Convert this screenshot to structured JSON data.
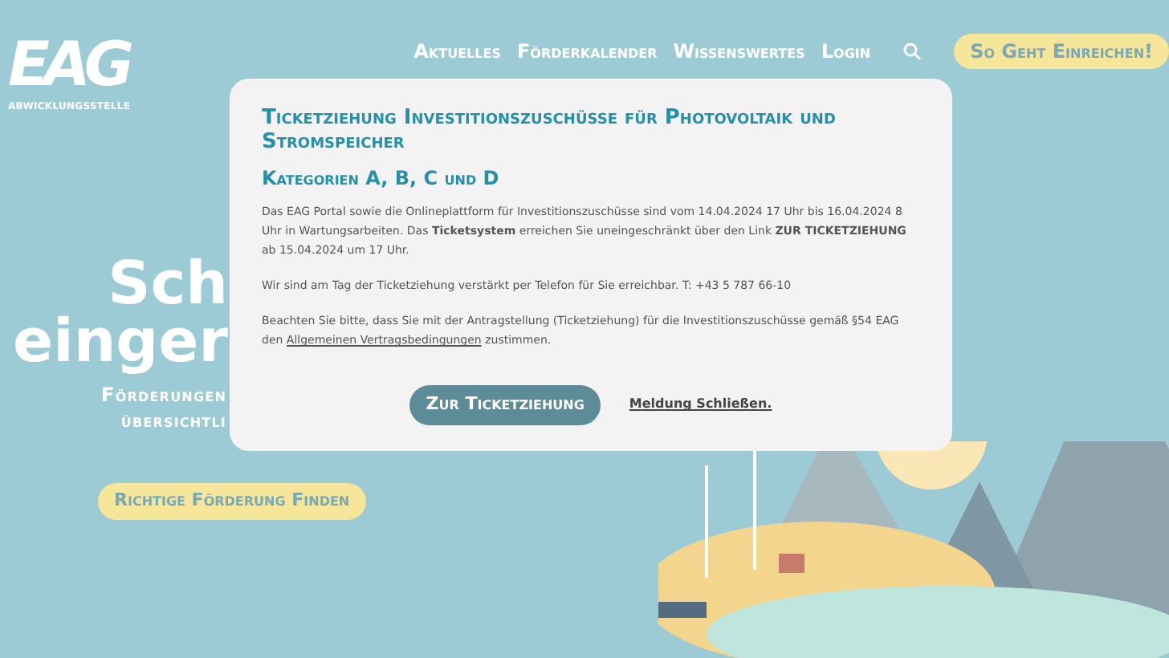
{
  "logo": {
    "letters": "EAG",
    "subtitle": "ABWICKLUNGSSTELLE"
  },
  "nav": {
    "items": [
      "Aktuelles",
      "Förderkalender",
      "Wissenswertes",
      "Login"
    ],
    "cta": "So Geht Einreichen!"
  },
  "hero": {
    "title_lines": [
      "Sch",
      "einger"
    ],
    "subtitle_lines": [
      "Förderungen",
      "übersichtli"
    ],
    "button": "Richtige Förderung Finden"
  },
  "modal": {
    "title": "Ticketziehung Investitionszuschüsse für Photovoltaik und Stromspeicher",
    "subtitle": "Kategorien A, B, C und D",
    "paragraphs": [
      {
        "text": "Das EAG Portal sowie die Onlineplattform für Investitionszuschüsse sind vom 14.04.2024 17 Uhr bis 16.04.2024 8 Uhr in Wartungsarbeiten. Das **Ticketsystem** erreichen Sie uneingeschränkt über den Link **ZUR TICKETZIEHUNG** ab 15.04.2024 um 17 Uhr."
      },
      {
        "text": "Wir sind am Tag der Ticketziehung verstärkt per Telefon für Sie erreichbar. T: +43 5 787 66-10"
      },
      {
        "text": "Beachten Sie bitte, dass Sie mit der Antragstellung (Ticketziehung) für die Investitionszuschüsse gemäß §54 EAG den",
        "link": "Allgemeinen Vertragsbedingungen",
        "after": "zustimmen."
      }
    ],
    "primary_button": "Zur Ticketziehung",
    "close_link": "Meldung Schließen."
  }
}
